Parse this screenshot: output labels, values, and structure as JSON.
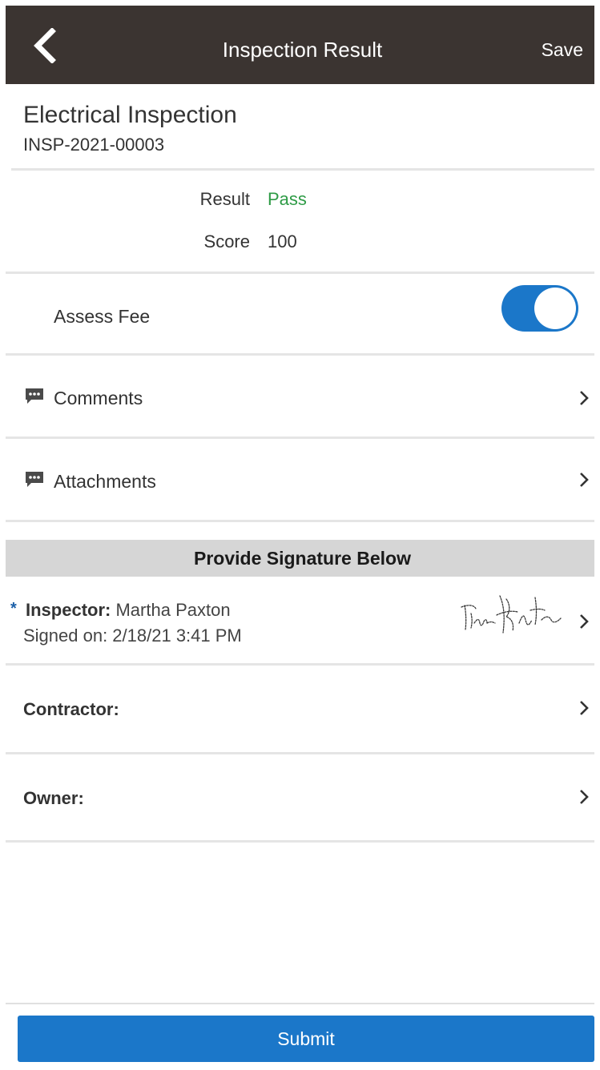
{
  "header": {
    "title": "Inspection Result",
    "back_icon": "chevron-left-icon",
    "save_label": "Save"
  },
  "inspection": {
    "title": "Electrical Inspection",
    "id": "INSP-2021-00003"
  },
  "result": {
    "result_label": "Result",
    "result_value": "Pass",
    "score_label": "Score",
    "score_value": "100",
    "pass_color": "#2e9b46"
  },
  "assess_fee": {
    "label": "Assess Fee",
    "enabled": true,
    "toggle_color": "#1b77c9"
  },
  "links": [
    {
      "label": "Comments",
      "icon": "comment-icon"
    },
    {
      "label": "Attachments",
      "icon": "comment-icon"
    }
  ],
  "signatures": {
    "header": "Provide Signature Below",
    "inspector": {
      "required_mark": "*",
      "label": "Inspector:",
      "name": "Martha Paxton",
      "signed_on": "Signed on: 2/18/21 3:41 PM"
    },
    "contractor": {
      "label": "Contractor:"
    },
    "owner": {
      "label": "Owner:"
    }
  },
  "footer": {
    "submit_label": "Submit",
    "button_color": "#1b77c9"
  }
}
